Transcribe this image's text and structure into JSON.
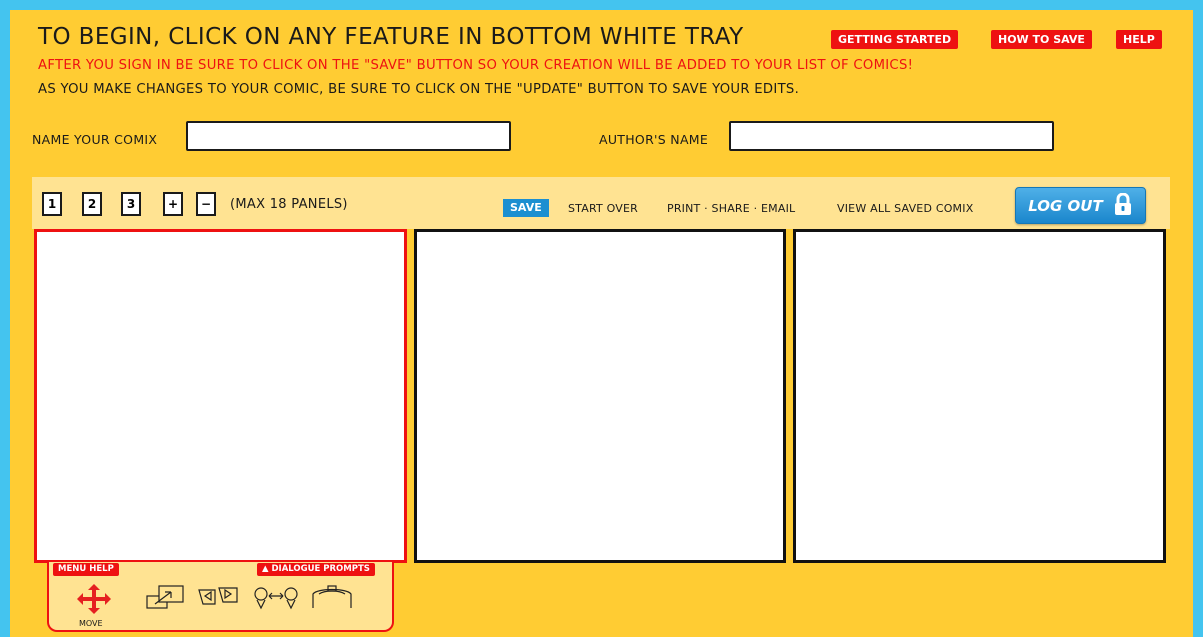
{
  "header": {
    "title": "TO BEGIN, CLICK ON ANY FEATURE IN BOTTOM WHITE TRAY",
    "buttons": {
      "getting_started": "GETTING STARTED",
      "how_to_save": "HOW TO SAVE",
      "help": "HELP"
    },
    "notice_save": "AFTER YOU SIGN IN BE SURE TO CLICK ON THE \"SAVE\" BUTTON SO YOUR CREATION WILL BE ADDED TO YOUR LIST OF COMICS!",
    "notice_update": "AS YOU MAKE CHANGES TO YOUR COMIC, BE SURE TO CLICK ON THE \"UPDATE\" BUTTON TO SAVE YOUR EDITS."
  },
  "form": {
    "comix_name_label": "NAME YOUR COMIX",
    "comix_name_value": "",
    "author_label": "AUTHOR'S NAME",
    "author_value": ""
  },
  "toolbar": {
    "panel_buttons": [
      "1",
      "2",
      "3"
    ],
    "add": "+",
    "remove": "−",
    "max_note": "(MAX 18 PANELS)",
    "save": "SAVE",
    "start_over": "START OVER",
    "print_share_email": "PRINT · SHARE · EMAIL",
    "view_all": "VIEW ALL SAVED COMIX",
    "logout": "LOG OUT"
  },
  "tray": {
    "menu_help": "MENU HELP",
    "dialogue_prompts": "▲ DIALOGUE PROMPTS",
    "move_label": "MOVE",
    "tools": [
      "move-icon",
      "resize-icon",
      "flip-icon",
      "swap-characters-icon",
      "layer-icon"
    ]
  },
  "colors": {
    "background": "#44c4ef",
    "app": "#ffcc33",
    "toolbar": "#ffe392",
    "accent_red": "#ee1111",
    "accent_blue": "#1b8fd1"
  }
}
